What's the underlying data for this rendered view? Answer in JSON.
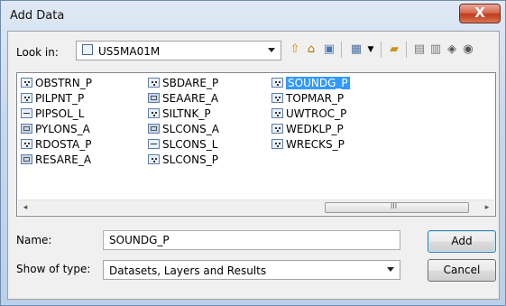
{
  "window": {
    "title": "Add Data",
    "close_glyph": "X"
  },
  "look_in": {
    "label": "Look in:",
    "value": "US5MA01M"
  },
  "toolbar": {
    "icons": [
      "up-one-level-icon",
      "home-icon",
      "connect-folder-icon",
      "view-menu-icon",
      "new-folder-icon",
      "catalog-icon",
      "toolbox-icon",
      "geodatabase-icon",
      "server-icon"
    ]
  },
  "files": [
    [
      {
        "name": "OBSTRN_P",
        "type": "point"
      },
      {
        "name": "PILPNT_P",
        "type": "point"
      },
      {
        "name": "PIPSOL_L",
        "type": "line"
      },
      {
        "name": "PYLONS_A",
        "type": "polygon"
      },
      {
        "name": "RDOSTA_P",
        "type": "point"
      },
      {
        "name": "RESARE_A",
        "type": "polygon"
      }
    ],
    [
      {
        "name": "SBDARE_P",
        "type": "point"
      },
      {
        "name": "SEAARE_A",
        "type": "polygon"
      },
      {
        "name": "SILTNK_P",
        "type": "point"
      },
      {
        "name": "SLCONS_A",
        "type": "polygon"
      },
      {
        "name": "SLCONS_L",
        "type": "line"
      },
      {
        "name": "SLCONS_P",
        "type": "point"
      }
    ],
    [
      {
        "name": "SOUNDG_P",
        "type": "point",
        "selected": true
      },
      {
        "name": "TOPMAR_P",
        "type": "point"
      },
      {
        "name": "UWTROC_P",
        "type": "point"
      },
      {
        "name": "WEDKLP_P",
        "type": "point"
      },
      {
        "name": "WRECKS_P",
        "type": "point"
      }
    ]
  ],
  "scrollbar": {
    "left_arrow": "◂",
    "right_arrow": "▸",
    "thumb_grip": "III"
  },
  "name_field": {
    "label": "Name:",
    "value": "SOUNDG_P"
  },
  "type_field": {
    "label": "Show of type:",
    "value": "Datasets, Layers and Results"
  },
  "buttons": {
    "add": "Add",
    "cancel": "Cancel"
  },
  "colors": {
    "selection": "#3399ff",
    "close_button": "#c0391b"
  }
}
